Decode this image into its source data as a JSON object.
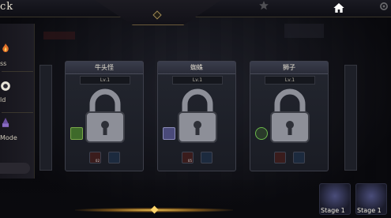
{
  "header": {
    "back_label": "ck",
    "home_icon": "home-icon",
    "star_icon": "star-icon",
    "gear_icon": "gear-icon"
  },
  "sidebar": {
    "items": [
      {
        "label": "ss",
        "icon": "flame-icon"
      },
      {
        "label": "ld",
        "icon": "badge-icon"
      },
      {
        "label": "Mode",
        "icon": "mage-icon"
      }
    ]
  },
  "cards": [
    {
      "name": "牛头怪",
      "level": "Lv.1",
      "locked": true
    },
    {
      "name": "蜘蛛",
      "level": "Lv.1",
      "locked": true
    },
    {
      "name": "狮子",
      "level": "Lv.1",
      "locked": true
    }
  ],
  "bottom": {
    "stage_labels": [
      "Stage 1",
      "Stage 1"
    ]
  },
  "colors": {
    "accent_gold": "#ffd46a",
    "card_header": "#3a3d4c",
    "lock_metal": "#8d8f98"
  }
}
